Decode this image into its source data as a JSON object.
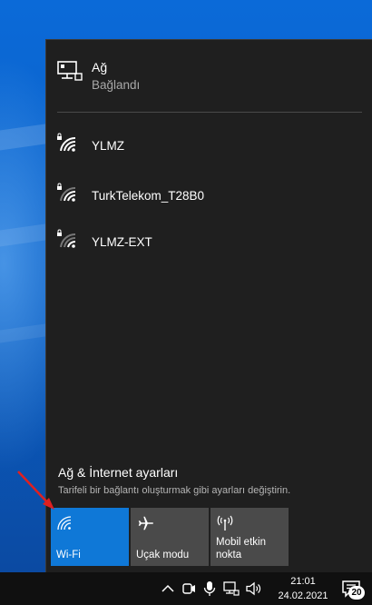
{
  "network": {
    "title": "Ağ",
    "status": "Bağlandı",
    "icon": "ethernet-monitor-icon"
  },
  "wifi_networks": [
    {
      "name": "YLMZ",
      "icon": "wifi-secured-icon"
    },
    {
      "name": "TurkTelekom_T28B0",
      "icon": "wifi-secured-icon"
    },
    {
      "name": "YLMZ-EXT",
      "icon": "wifi-secured-icon"
    }
  ],
  "settings": {
    "link_label": "Ağ & İnternet ayarları",
    "description": "Tarifeli bir bağlantı oluşturmak gibi ayarları değiştirin."
  },
  "quick_actions": [
    {
      "label": "Wi-Fi",
      "icon": "wifi-icon",
      "active": true
    },
    {
      "label": "Uçak modu",
      "icon": "airplane-icon",
      "active": false
    },
    {
      "label": "Mobil etkin nokta",
      "icon": "mobile-hotspot-icon",
      "active": false
    }
  ],
  "taskbar": {
    "time": "21:01",
    "date": "24.02.2021",
    "notification_count": "20"
  },
  "colors": {
    "accent": "#0f78d7",
    "flyout_bg": "#1f1f1f",
    "tile_bg": "#4a4a4a",
    "annotation_arrow": "#e02020"
  }
}
